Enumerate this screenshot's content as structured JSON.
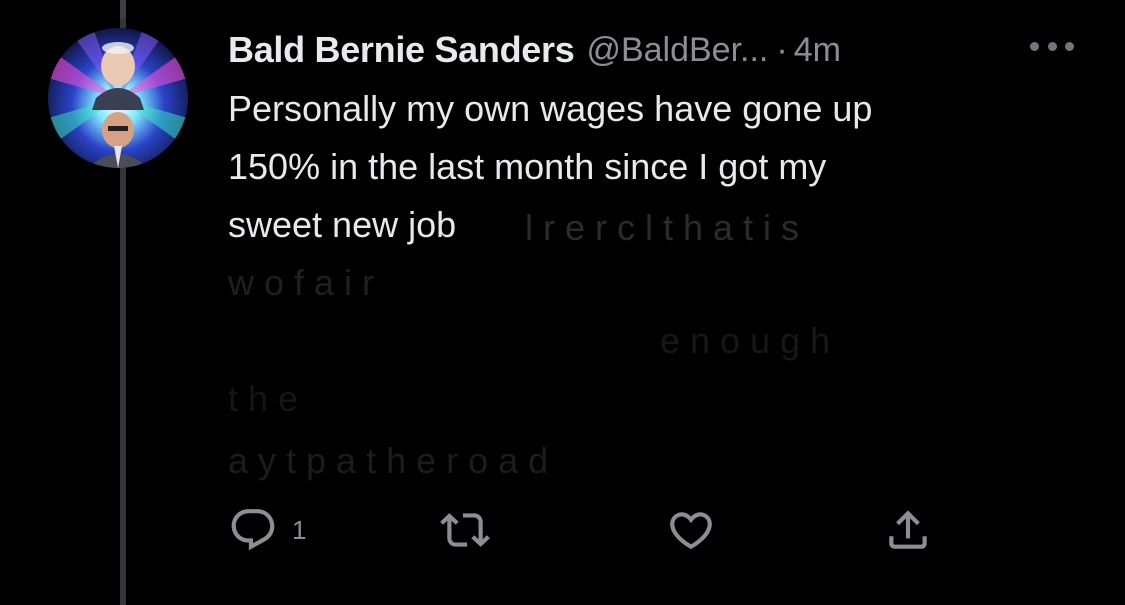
{
  "tweet": {
    "display_name": "Bald Bernie Sanders",
    "handle": "@BaldBer...",
    "separator": "·",
    "timestamp": "4m",
    "text_lines": [
      "Personally my own wages have gone up",
      "150% in the last month since I got my",
      "sweet new job"
    ],
    "faded_lines": [
      "l          r  e  r  c l     t  h  a  t  i  s",
      "w  o  f  a  i  r",
      "e  n  o  u  g  h",
      "t  h  e",
      "a       y         t   p  a  t  h  e   r  o  a  d"
    ]
  },
  "actions": {
    "reply_count": "1",
    "reply_icon": "speech-bubble-icon",
    "retweet_icon": "retweet-arrows-icon",
    "like_icon": "heart-outline-icon",
    "share_icon": "share-upload-icon",
    "more_icon": "ellipsis-icon"
  },
  "colors": {
    "background": "#000000",
    "text_primary": "#e7e9ea",
    "text_secondary": "#8b8f94",
    "thread_line": "#333639"
  }
}
